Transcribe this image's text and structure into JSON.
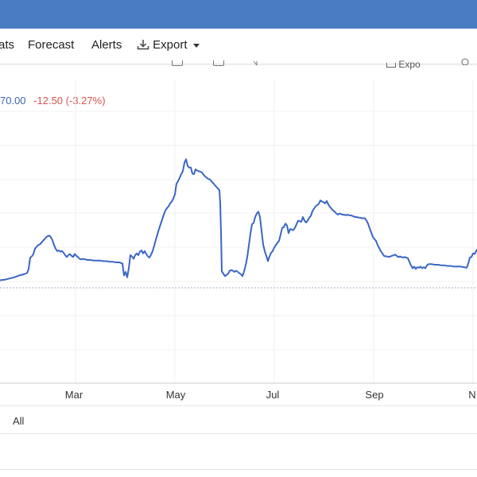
{
  "nav": {
    "items": [
      "ats",
      "Forecast",
      "Alerts"
    ],
    "export_label": "Export"
  },
  "toolbar": {
    "partial_label": "Expo"
  },
  "quote": {
    "last": "70.00",
    "change": "-12.50",
    "change_pct": "(-3.27%)"
  },
  "range": {
    "all_label": "All"
  },
  "colors": {
    "header": "#4a7cc3",
    "line": "#3a66c4",
    "negative": "#d9534f"
  },
  "chart_data": {
    "type": "line",
    "x_ticks": [
      "Mar",
      "May",
      "Jul",
      "Sep",
      "N"
    ],
    "series": [
      {
        "values": [
          [
            0,
            190
          ],
          [
            6,
            189
          ],
          [
            12,
            187
          ],
          [
            18,
            185
          ],
          [
            24,
            182
          ],
          [
            30,
            180
          ],
          [
            34,
            178
          ],
          [
            36,
            171
          ],
          [
            38,
            152
          ],
          [
            40,
            150
          ],
          [
            42,
            146
          ],
          [
            44,
            137
          ],
          [
            46,
            134
          ],
          [
            48,
            131
          ],
          [
            50,
            130
          ],
          [
            52,
            127
          ],
          [
            54,
            124
          ],
          [
            56,
            121
          ],
          [
            58,
            118
          ],
          [
            60,
            116
          ],
          [
            62,
            115
          ],
          [
            64,
            118
          ],
          [
            66,
            123
          ],
          [
            68,
            131
          ],
          [
            70,
            137
          ],
          [
            72,
            141
          ],
          [
            74,
            140
          ],
          [
            76,
            142
          ],
          [
            78,
            141
          ],
          [
            80,
            144
          ],
          [
            82,
            148
          ],
          [
            84,
            151
          ],
          [
            86,
            148
          ],
          [
            88,
            146
          ],
          [
            90,
            149
          ],
          [
            92,
            151
          ],
          [
            94,
            146
          ],
          [
            96,
            149
          ],
          [
            98,
            151
          ],
          [
            100,
            154
          ],
          [
            102,
            155
          ],
          [
            104,
            154
          ],
          [
            106,
            155
          ],
          [
            108,
            155
          ],
          [
            110,
            156
          ],
          [
            114,
            156
          ],
          [
            118,
            157
          ],
          [
            122,
            157
          ],
          [
            126,
            157
          ],
          [
            130,
            158
          ],
          [
            134,
            158
          ],
          [
            138,
            159
          ],
          [
            142,
            159
          ],
          [
            146,
            160
          ],
          [
            150,
            160
          ],
          [
            152,
            161
          ],
          [
            154,
            162
          ],
          [
            156,
            182
          ],
          [
            158,
            176
          ],
          [
            160,
            185
          ],
          [
            162,
            170
          ],
          [
            164,
            148
          ],
          [
            166,
            150
          ],
          [
            168,
            154
          ],
          [
            170,
            148
          ],
          [
            172,
            145
          ],
          [
            174,
            148
          ],
          [
            176,
            142
          ],
          [
            178,
            140
          ],
          [
            180,
            145
          ],
          [
            182,
            141
          ],
          [
            184,
            146
          ],
          [
            186,
            150
          ],
          [
            188,
            152
          ],
          [
            190,
            147
          ],
          [
            192,
            141
          ],
          [
            194,
            132
          ],
          [
            196,
            122
          ],
          [
            198,
            113
          ],
          [
            200,
            104
          ],
          [
            202,
            96
          ],
          [
            204,
            88
          ],
          [
            206,
            80
          ],
          [
            208,
            73
          ],
          [
            210,
            69
          ],
          [
            212,
            66
          ],
          [
            214,
            61
          ],
          [
            216,
            58
          ],
          [
            218,
            53
          ],
          [
            220,
            46
          ],
          [
            222,
            28
          ],
          [
            224,
            24
          ],
          [
            226,
            18
          ],
          [
            228,
            12
          ],
          [
            230,
            7
          ],
          [
            232,
            -7
          ],
          [
            234,
            -13
          ],
          [
            236,
            -2
          ],
          [
            238,
            1
          ],
          [
            240,
            1
          ],
          [
            242,
            11
          ],
          [
            244,
            12
          ],
          [
            246,
            4
          ],
          [
            248,
            6
          ],
          [
            250,
            7
          ],
          [
            252,
            8
          ],
          [
            254,
            9
          ],
          [
            256,
            13
          ],
          [
            258,
            16
          ],
          [
            260,
            18
          ],
          [
            262,
            20
          ],
          [
            264,
            21
          ],
          [
            266,
            24
          ],
          [
            268,
            27
          ],
          [
            270,
            30
          ],
          [
            272,
            33
          ],
          [
            274,
            36
          ],
          [
            276,
            39
          ],
          [
            277,
            60
          ],
          [
            278,
            110
          ],
          [
            279,
            175
          ],
          [
            281,
            179
          ],
          [
            283,
            183
          ],
          [
            285,
            181
          ],
          [
            287,
            179
          ],
          [
            289,
            174
          ],
          [
            291,
            173
          ],
          [
            293,
            174
          ],
          [
            295,
            176
          ],
          [
            297,
            174
          ],
          [
            299,
            176
          ],
          [
            301,
            178
          ],
          [
            303,
            180
          ],
          [
            305,
            183
          ],
          [
            307,
            175
          ],
          [
            309,
            165
          ],
          [
            311,
            151
          ],
          [
            313,
            132
          ],
          [
            315,
            112
          ],
          [
            317,
            96
          ],
          [
            319,
            94
          ],
          [
            321,
            84
          ],
          [
            323,
            78
          ],
          [
            325,
            75
          ],
          [
            327,
            84
          ],
          [
            329,
            107
          ],
          [
            331,
            130
          ],
          [
            333,
            141
          ],
          [
            335,
            149
          ],
          [
            337,
            158
          ],
          [
            339,
            150
          ],
          [
            341,
            144
          ],
          [
            343,
            141
          ],
          [
            345,
            135
          ],
          [
            347,
            131
          ],
          [
            349,
            127
          ],
          [
            351,
            124
          ],
          [
            353,
            113
          ],
          [
            355,
            102
          ],
          [
            357,
            101
          ],
          [
            359,
            95
          ],
          [
            361,
            98
          ],
          [
            363,
            111
          ],
          [
            365,
            104
          ],
          [
            367,
            105
          ],
          [
            369,
            106
          ],
          [
            371,
            102
          ],
          [
            373,
            96
          ],
          [
            375,
            90
          ],
          [
            377,
            91
          ],
          [
            379,
            92
          ],
          [
            381,
            84
          ],
          [
            383,
            90
          ],
          [
            385,
            93
          ],
          [
            387,
            90
          ],
          [
            389,
            85
          ],
          [
            391,
            82
          ],
          [
            393,
            74
          ],
          [
            395,
            70
          ],
          [
            397,
            66
          ],
          [
            399,
            64
          ],
          [
            401,
            62
          ],
          [
            403,
            56
          ],
          [
            405,
            58
          ],
          [
            407,
            59
          ],
          [
            409,
            61
          ],
          [
            411,
            57
          ],
          [
            413,
            63
          ],
          [
            415,
            67
          ],
          [
            417,
            70
          ],
          [
            419,
            73
          ],
          [
            421,
            75
          ],
          [
            423,
            78
          ],
          [
            425,
            80
          ],
          [
            427,
            78
          ],
          [
            429,
            79
          ],
          [
            431,
            80
          ],
          [
            433,
            80
          ],
          [
            435,
            81
          ],
          [
            437,
            80
          ],
          [
            439,
            81
          ],
          [
            441,
            81
          ],
          [
            443,
            82
          ],
          [
            445,
            83
          ],
          [
            447,
            84
          ],
          [
            449,
            84
          ],
          [
            451,
            85
          ],
          [
            453,
            85
          ],
          [
            455,
            86
          ],
          [
            457,
            86
          ],
          [
            459,
            86
          ],
          [
            461,
            90
          ],
          [
            463,
            95
          ],
          [
            465,
            103
          ],
          [
            467,
            110
          ],
          [
            469,
            117
          ],
          [
            471,
            121
          ],
          [
            473,
            124
          ],
          [
            475,
            131
          ],
          [
            477,
            136
          ],
          [
            479,
            141
          ],
          [
            481,
            145
          ],
          [
            483,
            149
          ],
          [
            485,
            150
          ],
          [
            487,
            150
          ],
          [
            489,
            151
          ],
          [
            491,
            150
          ],
          [
            493,
            149
          ],
          [
            495,
            148
          ],
          [
            497,
            147
          ],
          [
            499,
            149
          ],
          [
            501,
            151
          ],
          [
            503,
            150
          ],
          [
            505,
            151
          ],
          [
            507,
            152
          ],
          [
            509,
            151
          ],
          [
            511,
            152
          ],
          [
            513,
            153
          ],
          [
            515,
            159
          ],
          [
            517,
            165
          ],
          [
            519,
            170
          ],
          [
            521,
            167
          ],
          [
            523,
            171
          ],
          [
            525,
            168
          ],
          [
            527,
            169
          ],
          [
            529,
            167
          ],
          [
            531,
            170
          ],
          [
            533,
            168
          ],
          [
            535,
            170
          ],
          [
            537,
            165
          ],
          [
            539,
            163
          ],
          [
            543,
            163
          ],
          [
            547,
            164
          ],
          [
            551,
            164
          ],
          [
            555,
            165
          ],
          [
            559,
            165
          ],
          [
            563,
            166
          ],
          [
            567,
            166
          ],
          [
            571,
            167
          ],
          [
            575,
            167
          ],
          [
            579,
            167
          ],
          [
            583,
            168
          ],
          [
            587,
            169
          ],
          [
            589,
            162
          ],
          [
            591,
            152
          ],
          [
            593,
            151
          ],
          [
            595,
            145
          ],
          [
            597,
            146
          ],
          [
            599,
            141
          ],
          [
            600,
            138
          ]
        ]
      }
    ]
  }
}
